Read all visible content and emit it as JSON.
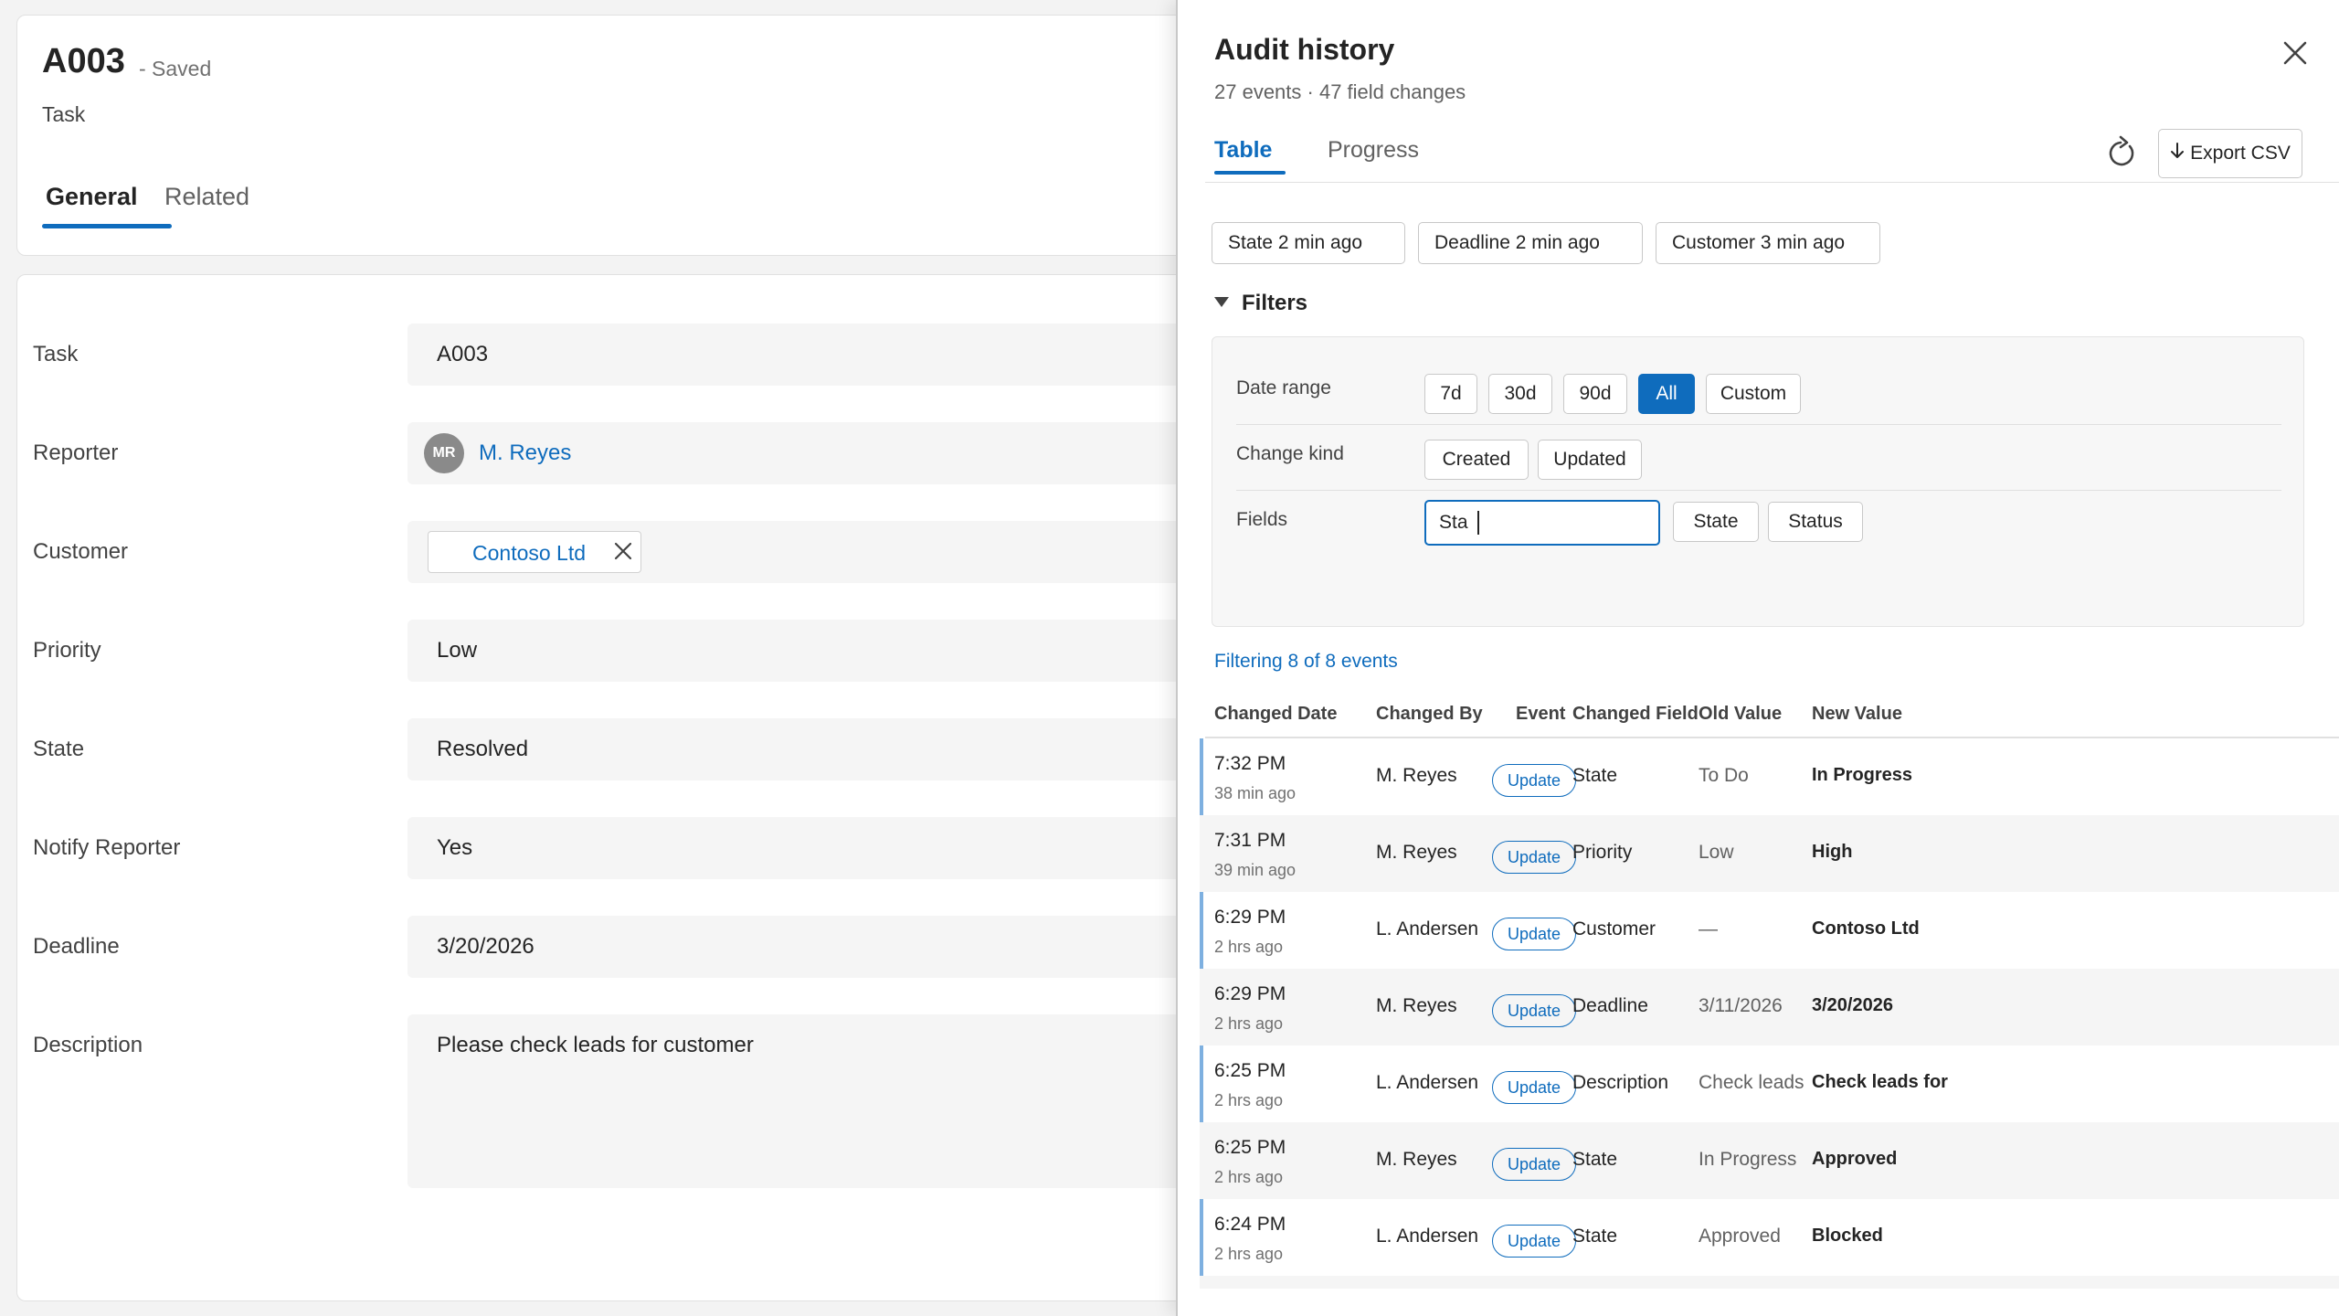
{
  "record": {
    "title": "A003",
    "saved_status": "- Saved",
    "entity_type": "Task",
    "tabs": [
      "General",
      "Related"
    ],
    "fields": [
      {
        "label": "Task",
        "value": "A003"
      },
      {
        "label": "Reporter",
        "value": "M. Reyes",
        "avatar_initials": "MR"
      },
      {
        "label": "Customer",
        "value": "Contoso Ltd"
      },
      {
        "label": "Priority",
        "value": "Low"
      },
      {
        "label": "State",
        "value": "Resolved"
      },
      {
        "label": "Notify Reporter",
        "value": "Yes"
      },
      {
        "label": "Deadline",
        "value": "3/20/2026"
      },
      {
        "label": "Description",
        "value": "Please check leads for customer"
      }
    ]
  },
  "panel": {
    "title": "Audit history",
    "subtitle": "27 events · 47 field changes",
    "tabs": [
      "Table",
      "Progress"
    ],
    "export_label": "Export CSV",
    "quick_chips": [
      "State 2 min ago",
      "Deadline 2 min ago",
      "Customer 3 min ago"
    ],
    "filters_label": "Filters",
    "filters": {
      "date_range_label": "Date range",
      "date_range_options": [
        "7d",
        "30d",
        "90d",
        "All",
        "Custom"
      ],
      "date_range_selected": "All",
      "change_kind_label": "Change kind",
      "change_kind_options": [
        "Created",
        "Updated"
      ],
      "fields_label": "Fields",
      "fields_input_value": "Sta",
      "fields_suggestions": [
        "State",
        "Status"
      ]
    },
    "filtering_text": "Filtering 8 of 8 events",
    "table": {
      "columns": [
        "Changed Date",
        "Changed By",
        "Event",
        "Changed Field",
        "Old Value",
        "New Value"
      ],
      "rows": [
        {
          "time": "7:32 PM",
          "ago": "38 min ago",
          "by": "M. Reyes",
          "event": "Update",
          "field": "State",
          "old": "To Do",
          "new": "In Progress"
        },
        {
          "time": "7:31 PM",
          "ago": "39 min ago",
          "by": "M. Reyes",
          "event": "Update",
          "field": "Priority",
          "old": "Low",
          "new": "High"
        },
        {
          "time": "6:29 PM",
          "ago": "2 hrs ago",
          "by": "L. Andersen",
          "event": "Update",
          "field": "Customer",
          "old": "—",
          "new": "Contoso Ltd"
        },
        {
          "time": "6:29 PM",
          "ago": "2 hrs ago",
          "by": "M. Reyes",
          "event": "Update",
          "field": "Deadline",
          "old": "3/11/2026",
          "new": "3/20/2026"
        },
        {
          "time": "6:25 PM",
          "ago": "2 hrs ago",
          "by": "L. Andersen",
          "event": "Update",
          "field": "Description",
          "old": "Check leads",
          "new": "Check leads for"
        },
        {
          "time": "6:25 PM",
          "ago": "2 hrs ago",
          "by": "M. Reyes",
          "event": "Update",
          "field": "State",
          "old": "In Progress",
          "new": "Approved"
        },
        {
          "time": "6:24 PM",
          "ago": "2 hrs ago",
          "by": "L. Andersen",
          "event": "Update",
          "field": "State",
          "old": "Approved",
          "new": "Blocked"
        }
      ]
    }
  },
  "colors": {
    "accent": "#0f6cbd",
    "row_accent": "#7eb0e0"
  }
}
